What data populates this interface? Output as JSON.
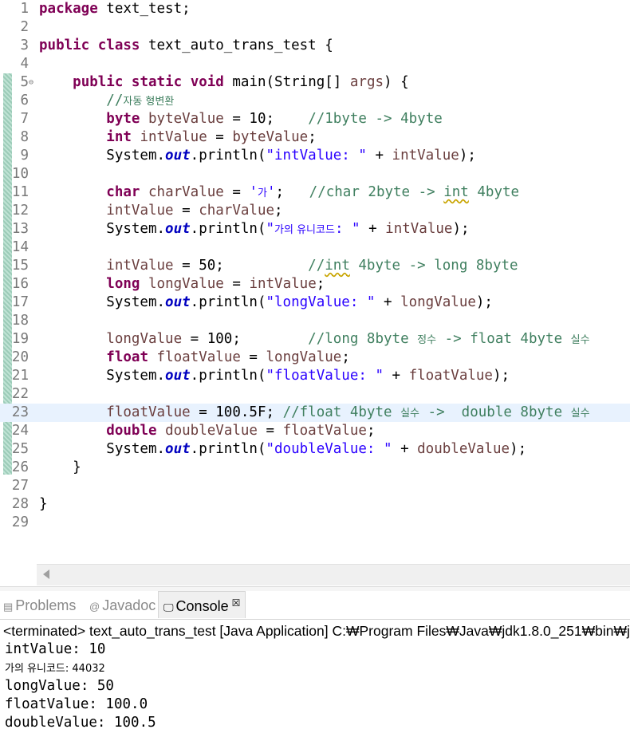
{
  "editor": {
    "lines": [
      {
        "n": "1",
        "segs": [
          [
            "kw",
            "package"
          ],
          [
            "pln",
            " text_test;"
          ]
        ]
      },
      {
        "n": "2",
        "segs": []
      },
      {
        "n": "3",
        "segs": [
          [
            "kw",
            "public"
          ],
          [
            "pln",
            " "
          ],
          [
            "kw",
            "class"
          ],
          [
            "pln",
            " text_auto_trans_test {"
          ]
        ]
      },
      {
        "n": "4",
        "segs": []
      },
      {
        "n": "5",
        "fold": "⊖",
        "segs": [
          [
            "pln",
            "    "
          ],
          [
            "kw",
            "public"
          ],
          [
            "pln",
            " "
          ],
          [
            "kw",
            "static"
          ],
          [
            "pln",
            " "
          ],
          [
            "kw",
            "void"
          ],
          [
            "pln",
            " main(String[] "
          ],
          [
            "var",
            "args"
          ],
          [
            "pln",
            ") {"
          ]
        ]
      },
      {
        "n": "6",
        "segs": [
          [
            "pln",
            "        "
          ],
          [
            "cmt",
            "//"
          ],
          [
            "cmt ko",
            "자동 형변환"
          ]
        ]
      },
      {
        "n": "7",
        "segs": [
          [
            "pln",
            "        "
          ],
          [
            "kw",
            "byte"
          ],
          [
            "pln",
            " "
          ],
          [
            "var",
            "byteValue"
          ],
          [
            "pln",
            " = 10;    "
          ],
          [
            "cmt",
            "//1byte -> 4byte"
          ]
        ]
      },
      {
        "n": "8",
        "segs": [
          [
            "pln",
            "        "
          ],
          [
            "kw",
            "int"
          ],
          [
            "pln",
            " "
          ],
          [
            "var",
            "intValue"
          ],
          [
            "pln",
            " = "
          ],
          [
            "var",
            "byteValue"
          ],
          [
            "pln",
            ";"
          ]
        ]
      },
      {
        "n": "9",
        "segs": [
          [
            "pln",
            "        System."
          ],
          [
            "fld",
            "out"
          ],
          [
            "pln",
            ".println("
          ],
          [
            "str",
            "\"intValue: \""
          ],
          [
            "pln",
            " + "
          ],
          [
            "var",
            "intValue"
          ],
          [
            "pln",
            ");"
          ]
        ]
      },
      {
        "n": "10",
        "segs": []
      },
      {
        "n": "11",
        "segs": [
          [
            "pln",
            "        "
          ],
          [
            "kw",
            "char"
          ],
          [
            "pln",
            " "
          ],
          [
            "var",
            "charValue"
          ],
          [
            "pln",
            " = "
          ],
          [
            "str",
            "'"
          ],
          [
            "str ko",
            "가"
          ],
          [
            "str",
            "'"
          ],
          [
            "pln",
            ";   "
          ],
          [
            "cmt",
            "//char 2byte -> "
          ],
          [
            "cmt squig",
            "int"
          ],
          [
            "cmt",
            " 4byte"
          ]
        ]
      },
      {
        "n": "12",
        "segs": [
          [
            "pln",
            "        "
          ],
          [
            "var",
            "intValue"
          ],
          [
            "pln",
            " = "
          ],
          [
            "var",
            "charValue"
          ],
          [
            "pln",
            ";"
          ]
        ]
      },
      {
        "n": "13",
        "segs": [
          [
            "pln",
            "        System."
          ],
          [
            "fld",
            "out"
          ],
          [
            "pln",
            ".println("
          ],
          [
            "str",
            "\""
          ],
          [
            "str ko",
            "가의 유니코드"
          ],
          [
            "str",
            ": \""
          ],
          [
            "pln",
            " + "
          ],
          [
            "var",
            "intValue"
          ],
          [
            "pln",
            ");"
          ]
        ]
      },
      {
        "n": "14",
        "segs": []
      },
      {
        "n": "15",
        "segs": [
          [
            "pln",
            "        "
          ],
          [
            "var",
            "intValue"
          ],
          [
            "pln",
            " = 50;          "
          ],
          [
            "cmt",
            "//"
          ],
          [
            "cmt squig",
            "int"
          ],
          [
            "cmt",
            " 4byte -> long 8byte"
          ]
        ]
      },
      {
        "n": "16",
        "segs": [
          [
            "pln",
            "        "
          ],
          [
            "kw",
            "long"
          ],
          [
            "pln",
            " "
          ],
          [
            "var",
            "longValue"
          ],
          [
            "pln",
            " = "
          ],
          [
            "var",
            "intValue"
          ],
          [
            "pln",
            ";"
          ]
        ]
      },
      {
        "n": "17",
        "segs": [
          [
            "pln",
            "        System."
          ],
          [
            "fld",
            "out"
          ],
          [
            "pln",
            ".println("
          ],
          [
            "str",
            "\"longValue: \""
          ],
          [
            "pln",
            " + "
          ],
          [
            "var",
            "longValue"
          ],
          [
            "pln",
            ");"
          ]
        ]
      },
      {
        "n": "18",
        "segs": []
      },
      {
        "n": "19",
        "segs": [
          [
            "pln",
            "        "
          ],
          [
            "var",
            "longValue"
          ],
          [
            "pln",
            " = 100;        "
          ],
          [
            "cmt",
            "//long 8byte "
          ],
          [
            "cmt ko",
            "정수"
          ],
          [
            "cmt",
            " -> float 4byte "
          ],
          [
            "cmt ko",
            "실수"
          ]
        ]
      },
      {
        "n": "20",
        "segs": [
          [
            "pln",
            "        "
          ],
          [
            "kw",
            "float"
          ],
          [
            "pln",
            " "
          ],
          [
            "var",
            "floatValue"
          ],
          [
            "pln",
            " = "
          ],
          [
            "var",
            "longValue"
          ],
          [
            "pln",
            ";"
          ]
        ]
      },
      {
        "n": "21",
        "segs": [
          [
            "pln",
            "        System."
          ],
          [
            "fld",
            "out"
          ],
          [
            "pln",
            ".println("
          ],
          [
            "str",
            "\"floatValue: \""
          ],
          [
            "pln",
            " + "
          ],
          [
            "var",
            "floatValue"
          ],
          [
            "pln",
            ");"
          ]
        ]
      },
      {
        "n": "22",
        "segs": []
      },
      {
        "n": "23",
        "current": true,
        "segs": [
          [
            "pln",
            "        "
          ],
          [
            "var",
            "floatValue"
          ],
          [
            "pln",
            " = 100.5F; "
          ],
          [
            "cmt",
            "//float 4byte "
          ],
          [
            "cmt ko",
            "실수"
          ],
          [
            "cmt",
            " ->  double 8byte "
          ],
          [
            "cmt ko",
            "실수"
          ]
        ]
      },
      {
        "n": "24",
        "segs": [
          [
            "pln",
            "        "
          ],
          [
            "kw",
            "double"
          ],
          [
            "pln",
            " "
          ],
          [
            "var",
            "doubleValue"
          ],
          [
            "pln",
            " = "
          ],
          [
            "var",
            "floatValue"
          ],
          [
            "pln",
            ";"
          ]
        ]
      },
      {
        "n": "25",
        "segs": [
          [
            "pln",
            "        System."
          ],
          [
            "fld",
            "out"
          ],
          [
            "pln",
            ".println("
          ],
          [
            "str",
            "\"doubleValue: \""
          ],
          [
            "pln",
            " + "
          ],
          [
            "var",
            "doubleValue"
          ],
          [
            "pln",
            ");"
          ]
        ]
      },
      {
        "n": "26",
        "segs": [
          [
            "pln",
            "    }"
          ]
        ]
      },
      {
        "n": "27",
        "segs": []
      },
      {
        "n": "28",
        "segs": [
          [
            "pln",
            "}"
          ]
        ]
      },
      {
        "n": "29",
        "segs": []
      }
    ]
  },
  "tabs": {
    "problems": {
      "icon": "▤",
      "label": "Problems"
    },
    "javadoc": {
      "icon": "@",
      "label": "Javadoc"
    },
    "console": {
      "icon": "🖵",
      "label": "Console",
      "close": "☒"
    }
  },
  "console": {
    "header": "<terminated> text_auto_trans_test [Java Application] C:₩Program Files₩Java₩jdk1.8.0_251₩bin₩j",
    "output": [
      "intValue: 10",
      "가의 유니코드: 44032",
      "longValue: 50",
      "floatValue: 100.0",
      "doubleValue: 100.5"
    ]
  },
  "colors": {
    "keyword": "#7f0055",
    "string": "#2a00ff",
    "comment": "#3f7f5f",
    "field": "#0000c0",
    "variable": "#6a3e3e",
    "current_line": "#e8f2fe"
  }
}
